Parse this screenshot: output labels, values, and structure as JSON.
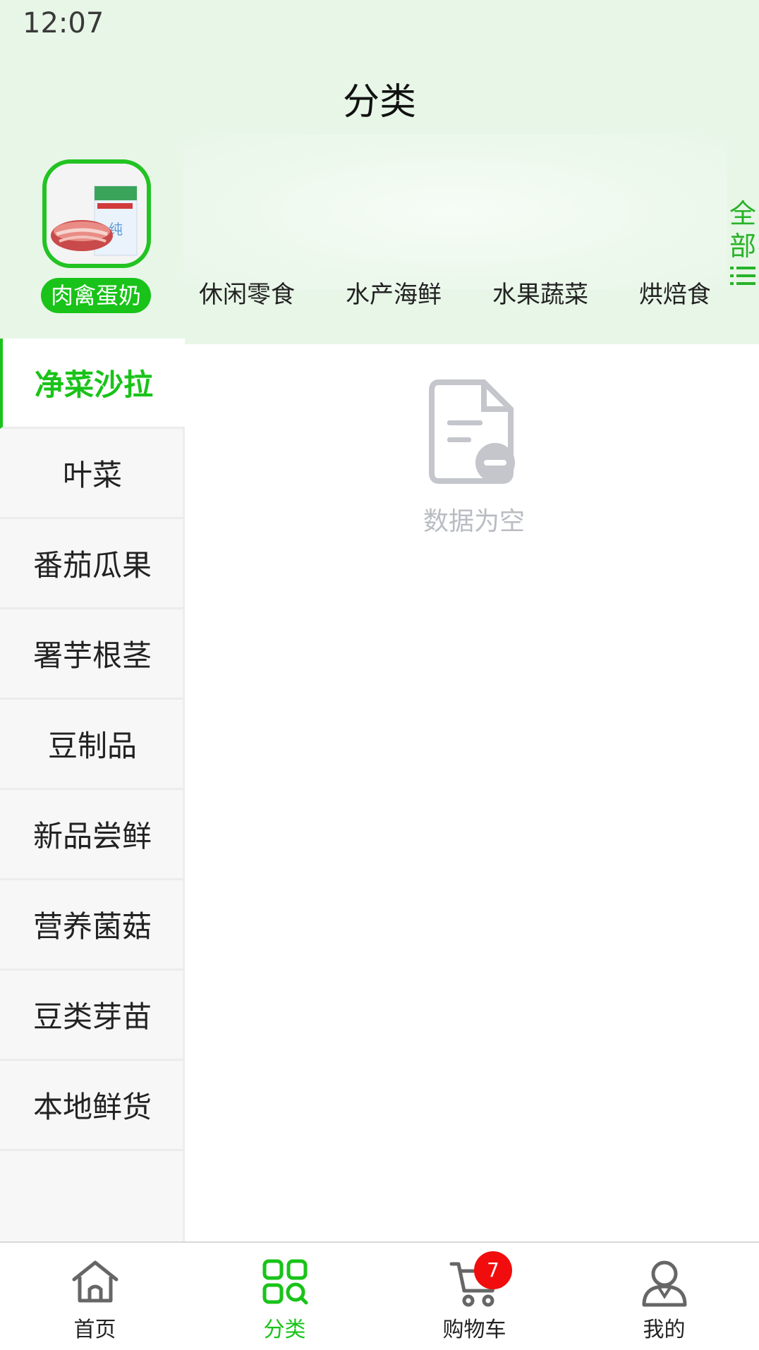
{
  "status_bar": {
    "time": "12:07"
  },
  "header": {
    "title": "分类"
  },
  "top_categories": {
    "items": [
      {
        "label": "肉禽蛋奶",
        "active": true
      },
      {
        "label": "休闲零食",
        "active": false
      },
      {
        "label": "水产海鲜",
        "active": false
      },
      {
        "label": "水果蔬菜",
        "active": false
      },
      {
        "label": "烘焙食",
        "active": false
      }
    ],
    "all_label": "全部",
    "all_icon": "list-icon"
  },
  "sidebar": {
    "items": [
      {
        "label": "净菜沙拉",
        "active": true
      },
      {
        "label": "叶菜",
        "active": false
      },
      {
        "label": "番茄瓜果",
        "active": false
      },
      {
        "label": "署芋根茎",
        "active": false
      },
      {
        "label": "豆制品",
        "active": false
      },
      {
        "label": "新品尝鲜",
        "active": false
      },
      {
        "label": "营养菌菇",
        "active": false
      },
      {
        "label": "豆类芽苗",
        "active": false
      },
      {
        "label": "本地鲜货",
        "active": false
      }
    ]
  },
  "main": {
    "empty_text": "数据为空",
    "empty_icon": "empty-document-icon"
  },
  "bottom_nav": {
    "items": [
      {
        "label": "首页",
        "icon": "home-icon",
        "active": false
      },
      {
        "label": "分类",
        "icon": "category-icon",
        "active": true
      },
      {
        "label": "购物车",
        "icon": "cart-icon",
        "active": false
      },
      {
        "label": "我的",
        "icon": "user-icon",
        "active": false
      }
    ],
    "cart_badge": "7"
  },
  "colors": {
    "accent": "#19c319",
    "header_bg": "#e8f6e8",
    "badge": "#f10d0d",
    "muted": "#b9bcc2"
  }
}
